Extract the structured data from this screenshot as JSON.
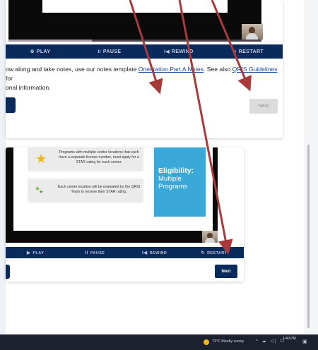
{
  "player_top": {
    "progress": 0.33,
    "controls": [
      {
        "icon": "⚙",
        "label": "PLAY"
      },
      {
        "icon": "II",
        "label": "PAUSE"
      },
      {
        "icon": "I◀",
        "label": "REWIND"
      },
      {
        "icon": "↻",
        "label": "RESTART"
      }
    ],
    "notes": {
      "text_1": "ow along and take notes, use our notes template ",
      "link_1": "Orientation Part A Notes",
      "text_2": ". See also ",
      "link_2": "QRIS Guidelines",
      "text_3": " for",
      "line_2": "onal information."
    },
    "next_label": "Next"
  },
  "player_bottom": {
    "info_boxes": [
      {
        "icon": "star-icon",
        "text": "Programs with multiple center locations that each have a separate license number, must apply for a STAR rating for each center."
      },
      {
        "icon": "green-stars-icon",
        "text": "Each center location will be evaluated by the QRIS Team to receive their STAR rating."
      }
    ],
    "panel_title": "Eligibility:",
    "panel_subtitle_1": "Multiple",
    "panel_subtitle_2": "Programs",
    "controls": [
      {
        "icon": "▶",
        "label": "PLAY"
      },
      {
        "icon": "II",
        "label": "PAUSE"
      },
      {
        "icon": "I◀",
        "label": "REWIND"
      },
      {
        "icon": "↻",
        "label": "RESTART"
      }
    ],
    "next_label": "Next"
  },
  "taskbar": {
    "weather": "73°F  Mostly sunny",
    "tray": "^ ☁ ◁) 🖵",
    "time": "1:40 PM",
    "date": "",
    "notification": "▣"
  },
  "colors": {
    "nav_dark": "#0b2a5c",
    "link": "#1b4aa8",
    "panel_blue": "#3aa8d8",
    "star": "#f2b416",
    "arrow": "#a83a3a",
    "taskbar": "#1c2130"
  }
}
